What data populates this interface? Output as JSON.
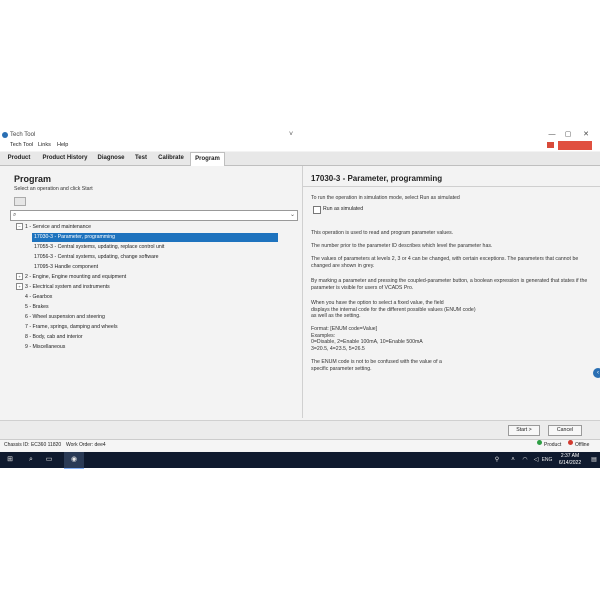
{
  "window": {
    "title": "Tech Tool",
    "caret": "˅",
    "buttons": [
      "—",
      "▢",
      "✕"
    ]
  },
  "menu": {
    "items": [
      "Tech Tool",
      "Links",
      "Help"
    ],
    "user_box": ""
  },
  "tabs": [
    "Product",
    "Product History",
    "Diagnose",
    "Test",
    "Calibrate",
    "Program"
  ],
  "active_tab": "Program",
  "left": {
    "heading": "Program",
    "subheading": "Select an operation and click Start",
    "search_placeholder": "",
    "tree": [
      {
        "label": "1 - Service and maintenance",
        "level": 0,
        "expander": "−"
      },
      {
        "label": "17030-3 - Parameter, programming",
        "level": 1,
        "selected": true
      },
      {
        "label": "17055-3 - Central systems, updating, replace control unit",
        "level": 1
      },
      {
        "label": "17056-3 - Central systems, updating, change software",
        "level": 1
      },
      {
        "label": "17095-3 Handle component",
        "level": 1
      },
      {
        "label": "2 - Engine, Engine mounting and equipment",
        "level": 0,
        "expander": "+"
      },
      {
        "label": "3 - Electrical system and instruments",
        "level": 0,
        "expander": "+"
      },
      {
        "label": "4 - Gearbox",
        "level": 0
      },
      {
        "label": "5 - Brakes",
        "level": 0
      },
      {
        "label": "6 - Wheel suspension and steering",
        "level": 0
      },
      {
        "label": "7 - Frame, springs, damping and wheels",
        "level": 0
      },
      {
        "label": "8 - Body, cab and interior",
        "level": 0
      },
      {
        "label": "9 - Miscellaneous",
        "level": 0
      }
    ]
  },
  "right": {
    "title": "17030-3 - Parameter, programming",
    "sim_instruction": "To run the operation in simulation mode, select Run as simulated",
    "checkbox_label": "Run as simulated",
    "p1": "This operation is used to read and program parameter values.",
    "p2": "The number prior to the parameter ID describes which level the parameter has.",
    "p3": "The values of parameters at levels 2, 3 or 4 can be changed, with certain exceptions. The parameters that cannot be changed are shown in grey.",
    "p4": "By marking a parameter and pressing the coupled-parameter button, a boolean expression is generated that states if the parameter is visible for users of VCADS Pro.",
    "p5a": "When you have the option to select a fixed value, the field",
    "p5b": "displays the internal code for the different possible values (ENUM code)",
    "p5c": "as well as the setting.",
    "p6a": "Format: [ENUM code=Value]",
    "p6b": "Examples:",
    "p6c": "0=Disable, 2=Enable 100mA, 10=Enable 500mA",
    "p6d": "3=20.5, 4=23.5, 5=26.5",
    "p7a": "The ENUM code is not to be confused with the value of a",
    "p7b": "specific parameter setting."
  },
  "buttons": {
    "start": "Start >",
    "cancel": "Cancel"
  },
  "status": {
    "chassis": "Chassis ID: EC360 11820",
    "work_order": "Work Order: dee4",
    "product": "Product",
    "offline": "Offline"
  },
  "taskbar": {
    "time": "2:37 AM",
    "date": "6/14/2022",
    "tray": "ENG"
  },
  "colors": {
    "accent": "#1e73be",
    "online": "#2e9e44",
    "offline": "#d23a2f",
    "taskbar": "#0f1a2e"
  }
}
